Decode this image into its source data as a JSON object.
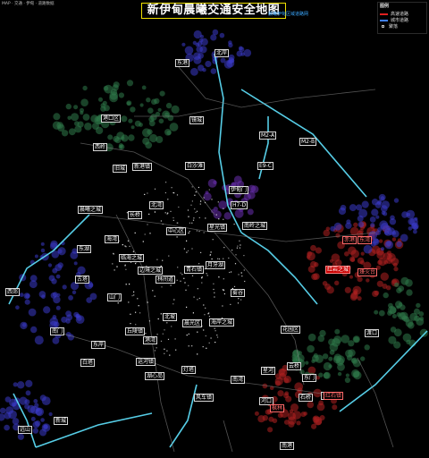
{
  "title": "新伊甸晨曦交通安全地图",
  "subtitle": "晨曦伊甸区域道路网",
  "top_info": "MAP · 交通 · 伊甸 · 道路数据",
  "legend": {
    "title": "图例",
    "items": [
      {
        "label": "高速道路",
        "color": "#e02020",
        "kind": "line"
      },
      {
        "label": "城市道路",
        "color": "#4080ff",
        "kind": "line"
      },
      {
        "label": "聚落",
        "color": "#000000",
        "kind": "dot"
      }
    ]
  },
  "colors": {
    "background": "#000000",
    "road_cyan": "#5fe3ff",
    "road_gray": "#8a8a8a",
    "label_border": "#d8d8d8",
    "red_label": "#ff6a6a",
    "zone_green": "#2f7a4a",
    "zone_blue": "#3a3ac8",
    "zone_red": "#b02020",
    "zone_purple": "#6a30b0"
  },
  "place_labels": [
    "东港",
    "北岸",
    "港口区",
    "镜城",
    "西岭",
    "旧城",
    "白沙滩",
    "新港镇",
    "伊甸门",
    "晨曦之城",
    "长桥",
    "北湾",
    "中心区",
    "星光镇",
    "南岭之城",
    "海湾",
    "东湖",
    "临海之城",
    "边境之城",
    "林间道",
    "青石镇",
    "月牙湖",
    "古塔",
    "山门",
    "西郊",
    "南门",
    "东岸",
    "白塔",
    "运河镇",
    "湖心岛",
    "北坡",
    "晨光区",
    "海岸之城",
    "丘陵镇",
    "港湾",
    "灯塔",
    "南湾",
    "风车镇",
    "雾谷",
    "花园区",
    "云桥",
    "星河",
    "东门",
    "河口",
    "石桥",
    "黄昏镇",
    "渡口",
    "南港",
    "新城",
    "远山"
  ],
  "red_labels": [
    "红岩之城",
    "赤港",
    "东湾",
    "烽火台",
    "红石镇",
    "枫林"
  ],
  "code_labels": [
    "M2-A",
    "M2-B",
    "E9-C",
    "H7-D"
  ]
}
